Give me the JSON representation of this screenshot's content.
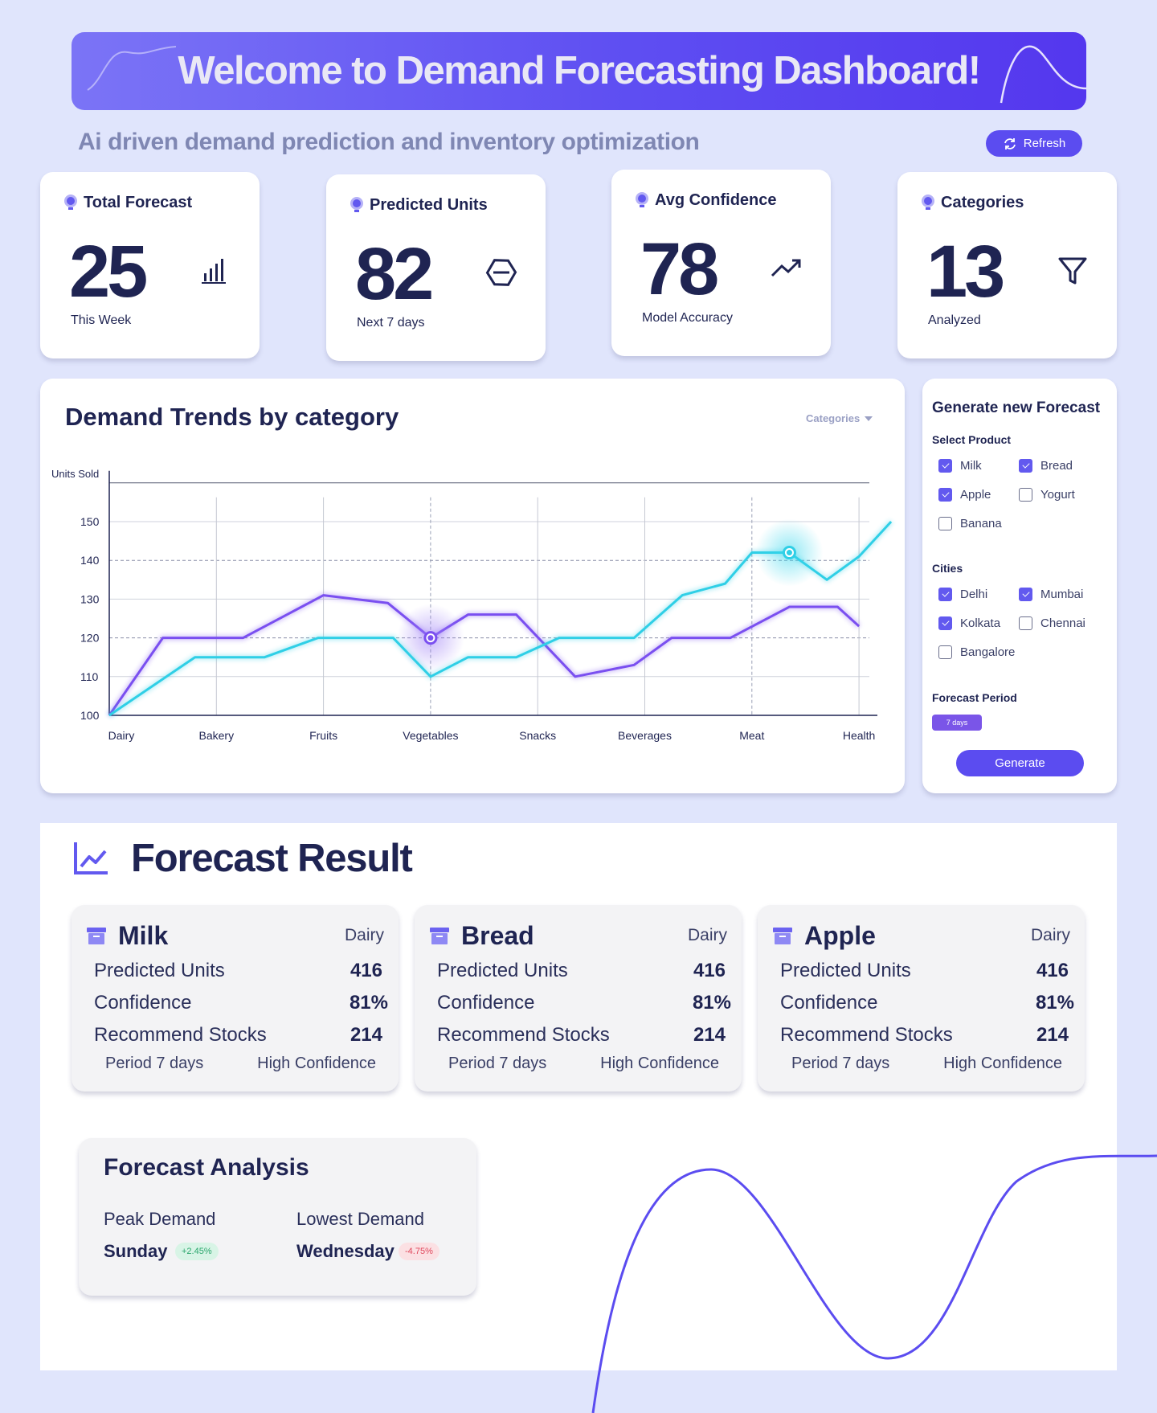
{
  "banner": {
    "title": "Welcome to Demand Forecasting Dashboard!"
  },
  "subtitle": "Ai driven demand prediction and inventory optimization",
  "refresh_label": "Refresh",
  "stats": [
    {
      "label": "Total Forecast",
      "value": "25",
      "sub": "This Week",
      "icon": "bar-chart-icon"
    },
    {
      "label": "Predicted Units",
      "value": "82",
      "sub": "Next 7 days",
      "icon": "hexagon-icon"
    },
    {
      "label": "Avg Confidence",
      "value": "78",
      "sub": "Model Accuracy",
      "icon": "trending-up-icon"
    },
    {
      "label": "Categories",
      "value": "13",
      "sub": "Analyzed",
      "icon": "filter-icon"
    }
  ],
  "trend_chart": {
    "title": "Demand Trends by category",
    "dropdown_label": "Categories"
  },
  "chart_data": {
    "type": "line",
    "title": "Demand Trends by category",
    "ylabel": "Units Sold",
    "xlabel": "",
    "x_ticks": [
      "Dairy",
      "Bakery",
      "Fruits",
      "Vegetables",
      "Snacks",
      "Beverages",
      "Meat",
      "Health"
    ],
    "y_ticks": [
      100,
      110,
      120,
      130,
      140,
      150
    ],
    "ylim": [
      100,
      160
    ],
    "grid": true,
    "series": [
      {
        "color": "#7a4ff0",
        "points": [
          [
            0,
            100
          ],
          [
            0.5,
            120
          ],
          [
            1.25,
            120
          ],
          [
            2,
            131
          ],
          [
            2.6,
            129
          ],
          [
            3,
            120
          ],
          [
            3.35,
            126
          ],
          [
            3.8,
            126
          ],
          [
            4.35,
            110
          ],
          [
            4.9,
            113
          ],
          [
            5.25,
            120
          ],
          [
            5.8,
            120
          ],
          [
            6.35,
            128
          ],
          [
            6.8,
            128
          ],
          [
            7,
            123
          ]
        ],
        "highlight": [
          3,
          120
        ]
      },
      {
        "color": "#2fcfe6",
        "points": [
          [
            0,
            100
          ],
          [
            0.8,
            115
          ],
          [
            1.45,
            115
          ],
          [
            1.95,
            120
          ],
          [
            2.65,
            120
          ],
          [
            3,
            110
          ],
          [
            3.35,
            115
          ],
          [
            3.8,
            115
          ],
          [
            4.2,
            120
          ],
          [
            4.9,
            120
          ],
          [
            5.35,
            131
          ],
          [
            5.75,
            134
          ],
          [
            6,
            142
          ],
          [
            6.35,
            142
          ],
          [
            6.7,
            135
          ],
          [
            7,
            141
          ],
          [
            7.3,
            150
          ]
        ],
        "highlight": [
          6.35,
          142
        ]
      }
    ]
  },
  "form": {
    "title": "Generate new Forecast",
    "product_label": "Select Product",
    "products": [
      {
        "label": "Milk",
        "checked": true
      },
      {
        "label": "Bread",
        "checked": true
      },
      {
        "label": "Apple",
        "checked": true
      },
      {
        "label": "Yogurt",
        "checked": false
      },
      {
        "label": "Banana",
        "checked": false
      }
    ],
    "cities_label": "Cities",
    "cities": [
      {
        "label": "Delhi",
        "checked": true
      },
      {
        "label": "Mumbai",
        "checked": true
      },
      {
        "label": "Kolkata",
        "checked": true
      },
      {
        "label": "Chennai",
        "checked": false
      },
      {
        "label": "Bangalore",
        "checked": false
      }
    ],
    "period_label": "Forecast Period",
    "period_value": "7 days",
    "generate_label": "Generate"
  },
  "results": {
    "title": "Forecast Result",
    "cards": [
      {
        "name": "Milk",
        "category": "Dairy",
        "predicted_label": "Predicted Units",
        "predicted": "416",
        "confidence_label": "Confidence",
        "confidence": "81%",
        "stock_label": "Recommend Stocks",
        "stock": "214",
        "period": "Period 7 days",
        "level": "High Confidence"
      },
      {
        "name": "Bread",
        "category": "Dairy",
        "predicted_label": "Predicted Units",
        "predicted": "416",
        "confidence_label": "Confidence",
        "confidence": "81%",
        "stock_label": "Recommend Stocks",
        "stock": "214",
        "period": "Period 7 days",
        "level": "High Confidence"
      },
      {
        "name": "Apple",
        "category": "Dairy",
        "predicted_label": "Predicted Units",
        "predicted": "416",
        "confidence_label": "Confidence",
        "confidence": "81%",
        "stock_label": "Recommend Stocks",
        "stock": "214",
        "period": "Period 7 days",
        "level": "High Confidence"
      }
    ]
  },
  "analysis": {
    "title": "Forecast Analysis",
    "peak_label": "Peak Demand",
    "peak_day": "Sunday",
    "peak_change": "+2.45%",
    "low_label": "Lowest Demand",
    "low_day": "Wednesday",
    "low_change": "-4.75%"
  },
  "colors": {
    "accent": "#5b4cf0",
    "background": "#e0e5fc",
    "text": "#1f2452",
    "cyan": "#2fcfe6",
    "purple": "#7a4ff0"
  }
}
